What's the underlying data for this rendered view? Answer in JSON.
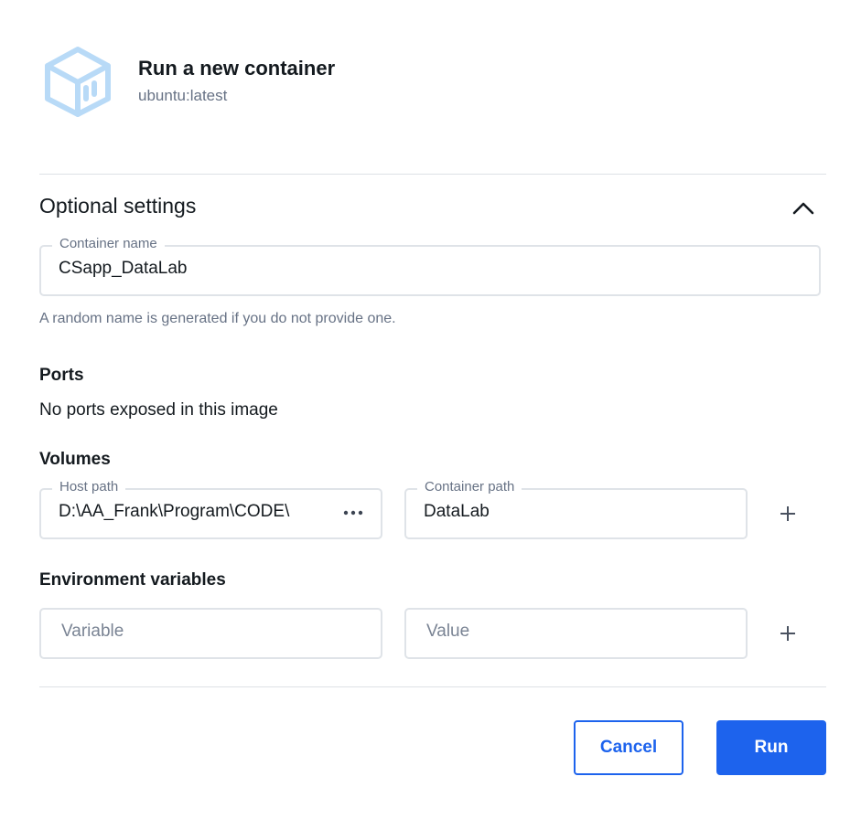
{
  "header": {
    "title": "Run a new container",
    "image_name": "ubuntu:latest",
    "icon": "container-cube-icon"
  },
  "optional_settings": {
    "title": "Optional settings",
    "expanded": true,
    "toggle_icon": "chevron-up-icon"
  },
  "container_name": {
    "label": "Container name",
    "value": "CSapp_DataLab",
    "helper": "A random name is generated if you do not provide one."
  },
  "ports": {
    "heading": "Ports",
    "message": "No ports exposed in this image"
  },
  "volumes": {
    "heading": "Volumes",
    "host_path_label": "Host path",
    "host_path_value": "D:\\AA_Frank\\Program\\CODE\\",
    "browse_icon": "ellipsis-icon",
    "container_path_label": "Container path",
    "container_path_value": "DataLab",
    "add_icon": "plus-icon"
  },
  "env": {
    "heading": "Environment variables",
    "variable_placeholder": "Variable",
    "value_placeholder": "Value",
    "add_icon": "plus-icon"
  },
  "actions": {
    "cancel_label": "Cancel",
    "run_label": "Run"
  },
  "colors": {
    "primary": "#1d63ed",
    "icon_light_blue": "#b8daf7",
    "muted_text": "#677285",
    "border": "#dfe3e8"
  }
}
